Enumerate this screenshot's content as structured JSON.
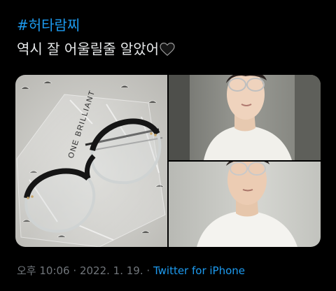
{
  "tweet": {
    "hashtag": "#허타람찌",
    "text": "역시 잘 어울릴줄 알았어",
    "text_emoji": "black-heart",
    "time": "오후 10:06",
    "separator": "·",
    "date": "2022. 1. 19.",
    "source": "Twitter for iPhone"
  },
  "media": {
    "photos": [
      {
        "name": "glasses-in-bag-photo",
        "brand_text": "ONE BRILLIANT"
      },
      {
        "name": "selfie-photo-top"
      },
      {
        "name": "selfie-photo-bottom"
      }
    ]
  },
  "colors": {
    "background": "#000000",
    "text": "#e7e9ea",
    "link": "#1d9bf0",
    "meta": "#71767b"
  }
}
